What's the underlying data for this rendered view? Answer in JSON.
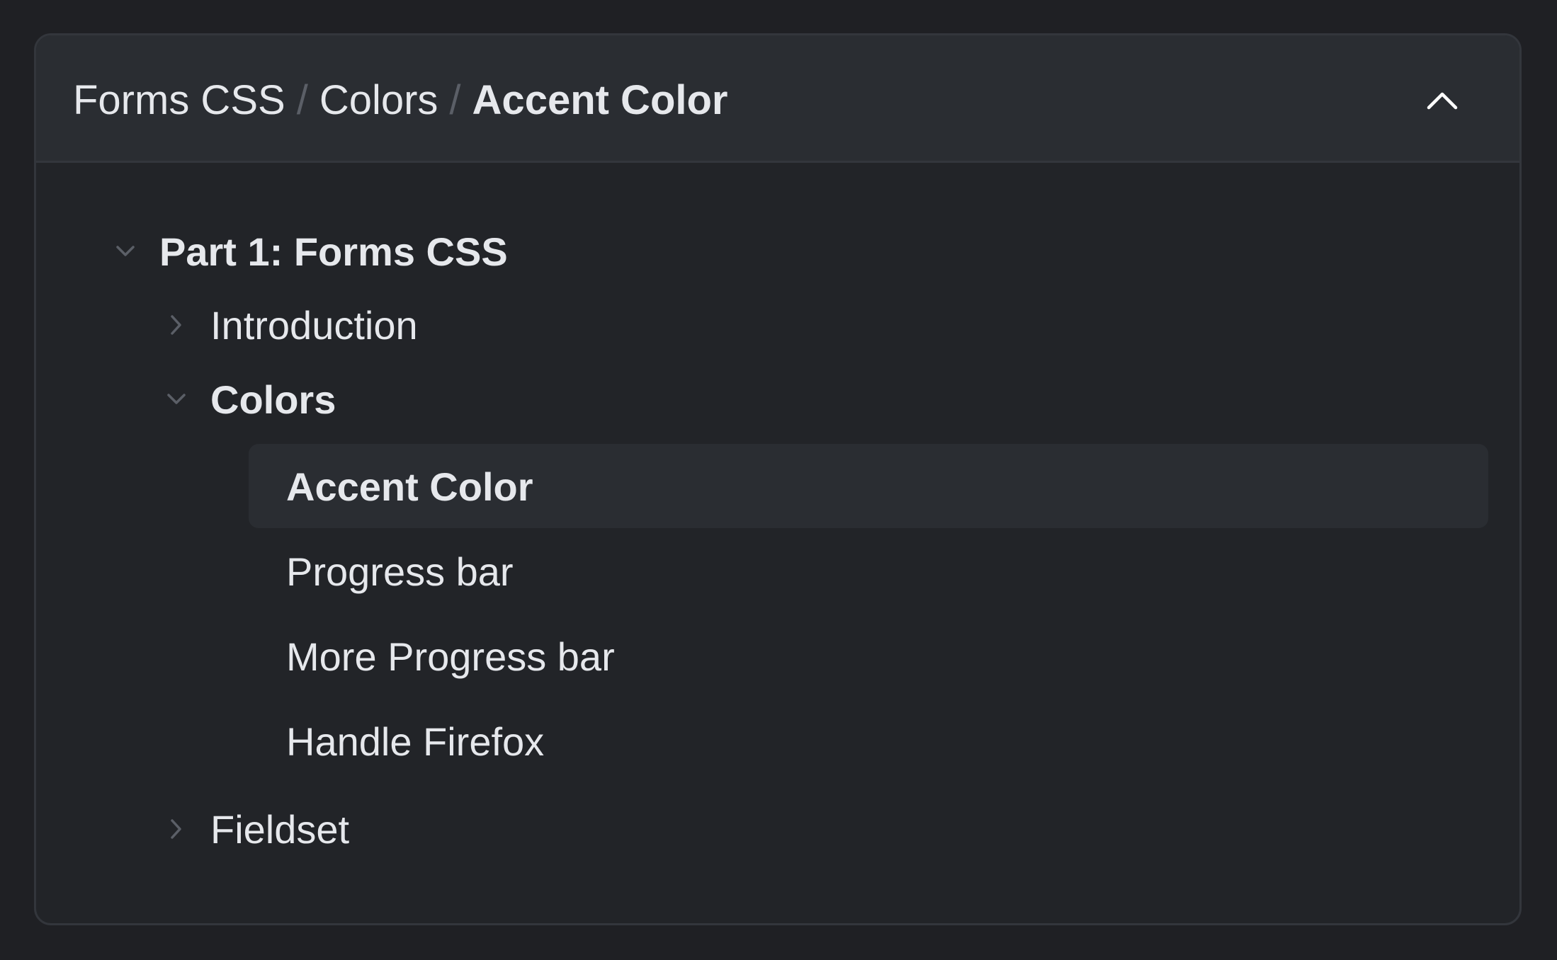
{
  "header": {
    "breadcrumb": [
      {
        "label": "Forms CSS"
      },
      {
        "label": "Colors"
      },
      {
        "label": "Accent Color"
      }
    ],
    "separator": "/",
    "collapse_icon": "chevron-up-icon"
  },
  "tree": {
    "part": {
      "label": "Part 1: Forms CSS",
      "expanded": true,
      "icon": "chevron-down-icon"
    },
    "sections": [
      {
        "label": "Introduction",
        "expanded": false,
        "icon": "chevron-right-icon"
      },
      {
        "label": "Colors",
        "expanded": true,
        "icon": "chevron-down-icon",
        "items": [
          {
            "label": "Accent Color",
            "selected": true
          },
          {
            "label": "Progress bar",
            "selected": false
          },
          {
            "label": "More Progress bar",
            "selected": false
          },
          {
            "label": "Handle Firefox",
            "selected": false
          }
        ]
      },
      {
        "label": "Fieldset",
        "expanded": false,
        "icon": "chevron-right-icon"
      }
    ]
  },
  "colors": {
    "page_bg": "#1f2024",
    "card_bg": "#222428",
    "header_bg": "#2a2d32",
    "border": "#33363c",
    "text": "#e6e8ec",
    "muted": "#5b5f67",
    "selected_bg": "#2a2d32"
  }
}
